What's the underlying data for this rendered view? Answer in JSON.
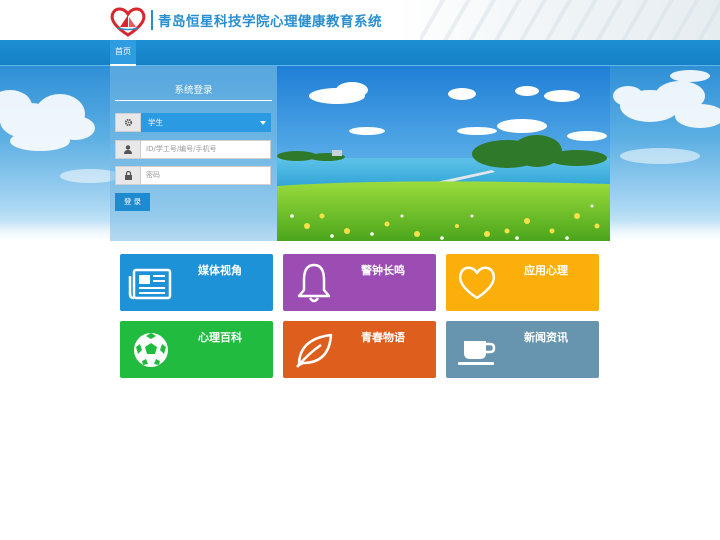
{
  "header": {
    "site_title": "青岛恒星科技学院心理健康教育系统",
    "logo_icon": "heart-sail-logo-icon"
  },
  "nav": {
    "items": [
      {
        "label": "首页",
        "active": true
      }
    ]
  },
  "login": {
    "title": "系统登录",
    "role_select": {
      "value": "学生",
      "icon": "gear-icon"
    },
    "username": {
      "placeholder": "ID/学工号/编号/手机号",
      "icon": "user-icon"
    },
    "password": {
      "placeholder": "密码",
      "icon": "lock-icon"
    },
    "submit_label": "登 录"
  },
  "tiles": [
    {
      "label": "媒体视角",
      "icon": "newspaper-icon",
      "color": "#1d92d6"
    },
    {
      "label": "警钟长鸣",
      "icon": "bell-icon",
      "color": "#9b4db4"
    },
    {
      "label": "应用心理",
      "icon": "heart-icon",
      "color": "#fcae0a"
    },
    {
      "label": "心理百科",
      "icon": "soccer-ball-icon",
      "color": "#20bb3f"
    },
    {
      "label": "青春物语",
      "icon": "leaf-icon",
      "color": "#de5e1d"
    },
    {
      "label": "新闻资讯",
      "icon": "coffee-cup-icon",
      "color": "#6794ae"
    }
  ]
}
